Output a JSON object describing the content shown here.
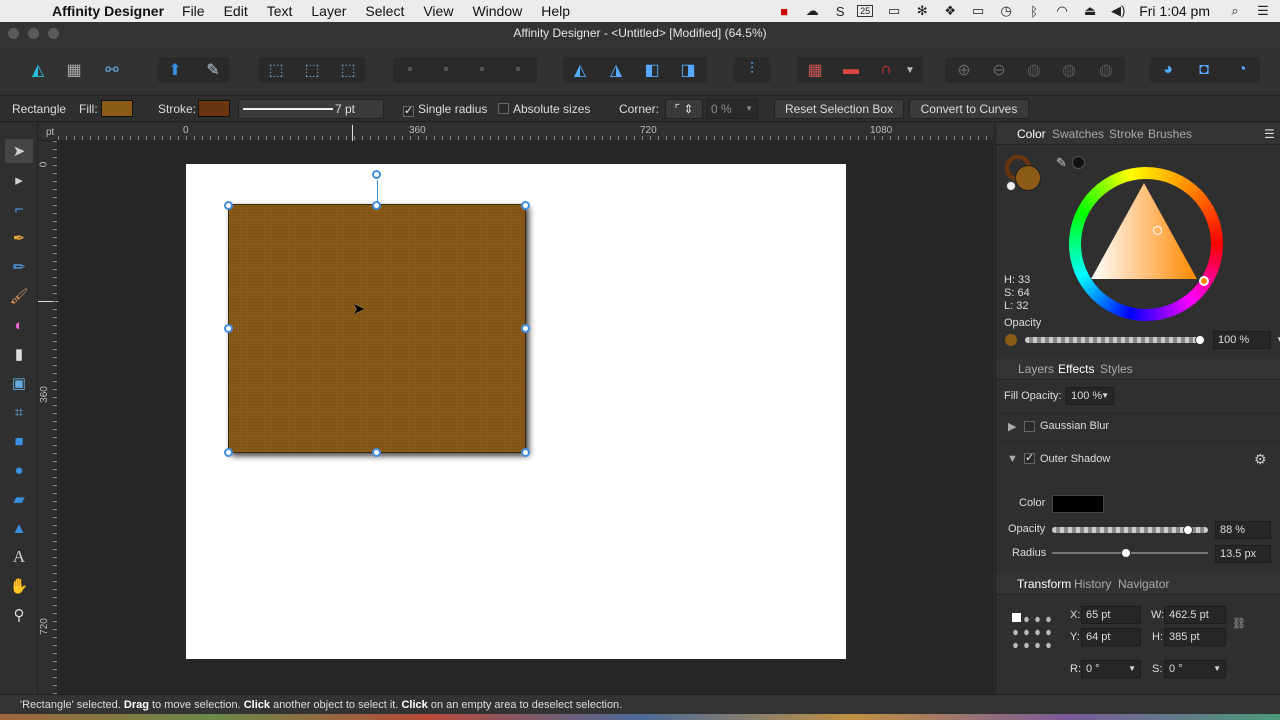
{
  "menubar": {
    "app_name": "Affinity Designer",
    "items": [
      "File",
      "Edit",
      "Text",
      "Layer",
      "Select",
      "View",
      "Window",
      "Help"
    ],
    "clock": "Fri 1:04 pm",
    "calendar_day": "25",
    "icon_names": [
      "video-icon",
      "cloud-icon",
      "skype-icon",
      "calendar-icon",
      "battery-icon",
      "network-icon",
      "dropbox-icon",
      "airplay-icon",
      "time-machine-icon",
      "bluetooth-icon",
      "wifi-icon",
      "eject-icon",
      "volume-icon",
      "spotlight-icon",
      "notification-center-icon"
    ]
  },
  "window": {
    "title": "Affinity Designer - <Untitled> [Modified] (64.5%)"
  },
  "context": {
    "tool_name": "Rectangle",
    "fill_label": "Fill:",
    "fill_color": "#8b5a17",
    "stroke_label": "Stroke:",
    "stroke_color": "#6b3510",
    "stroke_width": "7 pt",
    "single_radius_label": "Single radius",
    "absolute_sizes_label": "Absolute sizes",
    "corner_label": "Corner:",
    "corner_value": "0 %",
    "reset_button": "Reset Selection Box",
    "convert_button": "Convert to Curves"
  },
  "ruler": {
    "unit": "pt",
    "top_ticks": [
      "0",
      "360",
      "720",
      "1080"
    ],
    "left_ticks": [
      "0",
      "360",
      "720"
    ]
  },
  "color_panel": {
    "tabs": [
      "Color",
      "Swatches",
      "Stroke",
      "Brushes"
    ],
    "active_tab": "Color",
    "h": "H: 33",
    "s": "S: 64",
    "l": "L: 32",
    "opacity_label": "Opacity",
    "opacity_value": "100 %",
    "current_color": "#8b5a17"
  },
  "effects_panel": {
    "tabs": [
      "Layers",
      "Effects",
      "Styles"
    ],
    "active_tab": "Effects",
    "fill_opacity_label": "Fill Opacity:",
    "fill_opacity_value": "100 %",
    "gaussian_blur": "Gaussian Blur",
    "outer_shadow": "Outer Shadow",
    "color_label": "Color",
    "shadow_color": "#000000",
    "opacity_label": "Opacity",
    "opacity_value": "88 %",
    "radius_label": "Radius",
    "radius_value": "13.5 px"
  },
  "transform_panel": {
    "tabs": [
      "Transform",
      "History",
      "Navigator"
    ],
    "active_tab": "Transform",
    "x_label": "X:",
    "x_value": "65 pt",
    "y_label": "Y:",
    "y_value": "64 pt",
    "w_label": "W:",
    "w_value": "462.5 pt",
    "h_label": "H:",
    "h_value": "385 pt",
    "r_label": "R:",
    "r_value": "0 °",
    "s_label": "S:",
    "s_value": "0 °"
  },
  "status": {
    "part1": "'Rectangle' selected. ",
    "b1": "Drag",
    "part2": " to move selection. ",
    "b2": "Click",
    "part3": " another object to select it. ",
    "b3": "Click",
    "part4": " on an empty area to deselect selection."
  }
}
